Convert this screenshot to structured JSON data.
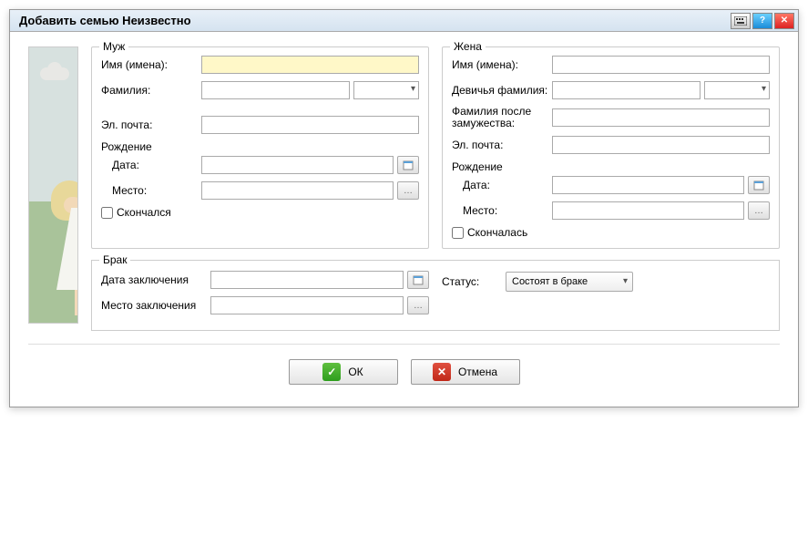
{
  "window": {
    "title": "Добавить семью Неизвестно"
  },
  "husband": {
    "legend": "Муж",
    "name_label": "Имя (имена):",
    "surname_label": "Фамилия:",
    "email_label": "Эл. почта:",
    "birth_label": "Рождение",
    "date_label": "Дата:",
    "place_label": "Место:",
    "deceased_label": "Скончался",
    "name_value": "",
    "surname_value": "",
    "surname_dd": "",
    "email_value": "",
    "date_value": "",
    "place_value": ""
  },
  "wife": {
    "legend": "Жена",
    "name_label": "Имя (имена):",
    "maiden_label": "Девичья фамилия:",
    "married_surname_label": "Фамилия после замужества:",
    "email_label": "Эл. почта:",
    "birth_label": "Рождение",
    "date_label": "Дата:",
    "place_label": "Место:",
    "deceased_label": "Скончалась",
    "name_value": "",
    "maiden_value": "",
    "maiden_dd": "",
    "married_surname_value": "",
    "email_value": "",
    "date_value": "",
    "place_value": ""
  },
  "marriage": {
    "legend": "Брак",
    "date_label": "Дата заключения",
    "place_label": "Место заключения",
    "status_label": "Статус:",
    "status_value": "Состоят в браке",
    "date_value": "",
    "place_value": ""
  },
  "buttons": {
    "ok": "ОК",
    "cancel": "Отмена"
  }
}
